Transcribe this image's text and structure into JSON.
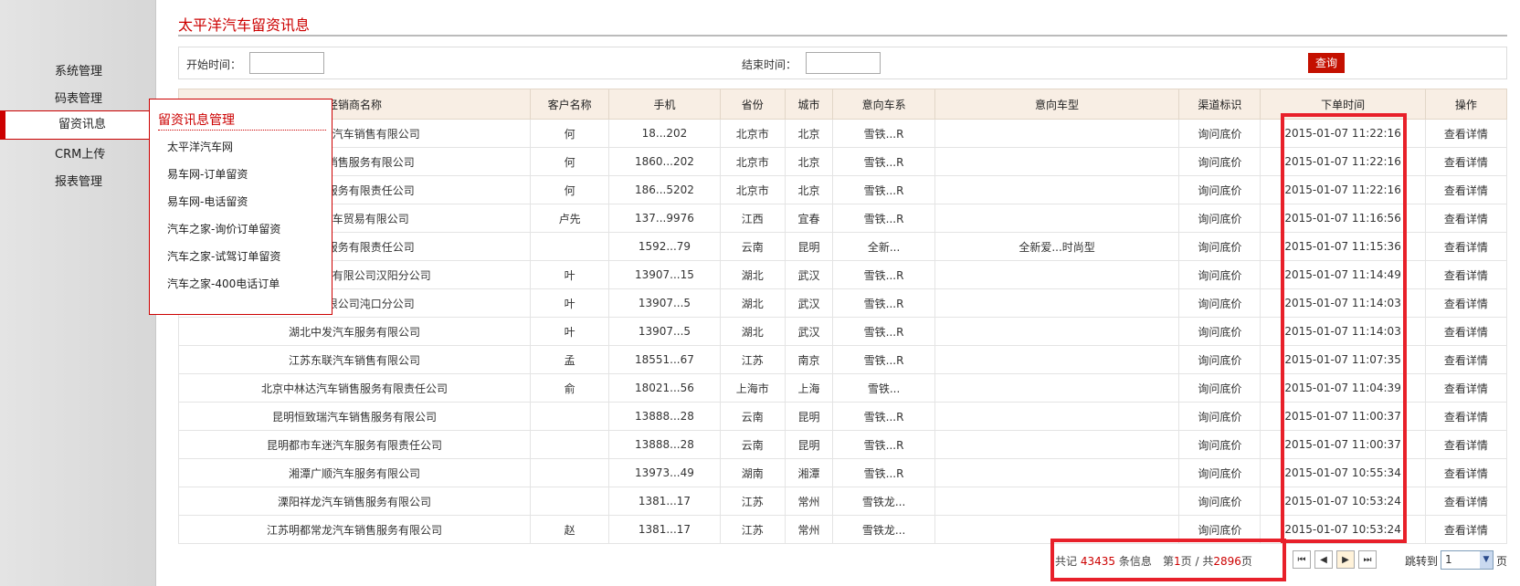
{
  "sidebar": {
    "items": [
      {
        "label": "系统管理"
      },
      {
        "label": "码表管理"
      },
      {
        "label": "留资讯息"
      },
      {
        "label": "CRM上传"
      },
      {
        "label": "报表管理"
      }
    ]
  },
  "page": {
    "title": "太平洋汽车留资讯息"
  },
  "search": {
    "start_label": "开始时间：",
    "end_label": "结束时间：",
    "start_value": "",
    "end_value": "",
    "query_label": "查询"
  },
  "table": {
    "headers": [
      "经销商名称",
      "客户名称",
      "手机",
      "省份",
      "城市",
      "意向车系",
      "意向车型",
      "渠道标识",
      "下单时间",
      "操作"
    ],
    "rows": [
      [
        "北京...津汽车销售有限公司",
        "何",
        "18...202",
        "北京市",
        "北京",
        "雪铁...R",
        "",
        "询问底价",
        "2015-01-07 11:22:16",
        "查看详情"
      ],
      [
        "...汽车销售服务有限公司",
        "何",
        "1860...202",
        "北京市",
        "北京",
        "雪铁...R",
        "",
        "询问底价",
        "2015-01-07 11:22:16",
        "查看详情"
      ],
      [
        "...销售服务有限责任公司",
        "何",
        "186...5202",
        "北京市",
        "北京",
        "雪铁...R",
        "",
        "询问底价",
        "2015-01-07 11:22:16",
        "查看详情"
      ],
      [
        "...驰汽车贸易有限公司",
        "卢先",
        "137...9976",
        "江西",
        "宜春",
        "雪铁...R",
        "",
        "询问底价",
        "2015-01-07 11:16:56",
        "查看详情"
      ],
      [
        "...汽车服务有限责任公司",
        "",
        "1592...79",
        "云南",
        "昆明",
        "全新...",
        "全新爱...时尚型",
        "询问底价",
        "2015-01-07 11:15:36",
        "查看详情"
      ],
      [
        "...销售服务有限公司汉阳分公司",
        "叶",
        "13907...15",
        "湖北",
        "武汉",
        "雪铁...R",
        "",
        "询问底价",
        "2015-01-07 11:14:49",
        "查看详情"
      ],
      [
        "...售有限公司沌口分公司",
        "叶",
        "13907...5",
        "湖北",
        "武汉",
        "雪铁...R",
        "",
        "询问底价",
        "2015-01-07 11:14:03",
        "查看详情"
      ],
      [
        "湖北中发汽车服务有限公司",
        "叶",
        "13907...5",
        "湖北",
        "武汉",
        "雪铁...R",
        "",
        "询问底价",
        "2015-01-07 11:14:03",
        "查看详情"
      ],
      [
        "江苏东联汽车销售有限公司",
        "孟",
        "18551...67",
        "江苏",
        "南京",
        "雪铁...R",
        "",
        "询问底价",
        "2015-01-07 11:07:35",
        "查看详情"
      ],
      [
        "北京中林达汽车销售服务有限责任公司",
        "俞",
        "18021...56",
        "上海市",
        "上海",
        "雪铁...",
        "",
        "询问底价",
        "2015-01-07 11:04:39",
        "查看详情"
      ],
      [
        "昆明恒致瑞汽车销售服务有限公司",
        "",
        "13888...28",
        "云南",
        "昆明",
        "雪铁...R",
        "",
        "询问底价",
        "2015-01-07 11:00:37",
        "查看详情"
      ],
      [
        "昆明都市车迷汽车服务有限责任公司",
        "",
        "13888...28",
        "云南",
        "昆明",
        "雪铁...R",
        "",
        "询问底价",
        "2015-01-07 11:00:37",
        "查看详情"
      ],
      [
        "湘潭广顺汽车服务有限公司",
        "",
        "13973...49",
        "湖南",
        "湘潭",
        "雪铁...R",
        "",
        "询问底价",
        "2015-01-07 10:55:34",
        "查看详情"
      ],
      [
        "溧阳祥龙汽车销售服务有限公司",
        "",
        "1381...17",
        "江苏",
        "常州",
        "雪铁龙...",
        "",
        "询问底价",
        "2015-01-07 10:53:24",
        "查看详情"
      ],
      [
        "江苏明都常龙汽车销售服务有限公司",
        "赵",
        "1381...17",
        "江苏",
        "常州",
        "雪铁龙...",
        "",
        "询问底价",
        "2015-01-07 10:53:24",
        "查看详情"
      ]
    ]
  },
  "popup": {
    "title": "留资讯息管理",
    "items": [
      "太平洋汽车网",
      "易车网-订单留资",
      "易车网-电话留资",
      "汽车之家-询价订单留资",
      "汽车之家-试驾订单留资",
      "汽车之家-400电话订单"
    ]
  },
  "pager": {
    "total_prefix": "共记",
    "total": "43435",
    "total_suffix": "条信息",
    "page_prefix": "第",
    "page": "1",
    "page_mid": "页 / 共",
    "pages": "2896",
    "page_suffix": "页",
    "jump_label": "跳转到",
    "selected_page": "1",
    "unit": "页"
  },
  "colors": {
    "accent": "#c41000",
    "link": "#2f9a1a",
    "highlight": "#e8202a",
    "header_bg": "#f8eee4"
  }
}
